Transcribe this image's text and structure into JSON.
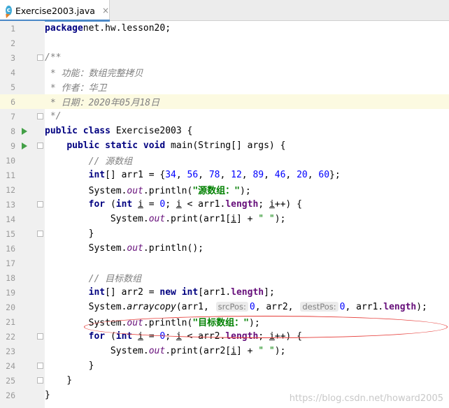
{
  "tab": {
    "filename": "Exercise2003.java",
    "icon": "java-class-icon",
    "close": "×"
  },
  "editor": {
    "current_line": 6,
    "line_numbers": [
      "1",
      "2",
      "3",
      "4",
      "5",
      "6",
      "7",
      "8",
      "9",
      "10",
      "11",
      "12",
      "13",
      "14",
      "15",
      "16",
      "17",
      "18",
      "19",
      "20",
      "21",
      "22",
      "23",
      "24",
      "25",
      "26"
    ],
    "lines": [
      [
        [
          "kw",
          "package"
        ],
        [
          "",
          "net.hw.lesson20;"
        ]
      ],
      [],
      [
        [
          "cmt",
          "/**"
        ]
      ],
      [
        [
          "cmt",
          " * 功能：数组完整拷贝"
        ]
      ],
      [
        [
          "cmt",
          " * 作者：华卫"
        ]
      ],
      [
        [
          "cmt",
          " * 日期：2020年05月18日"
        ]
      ],
      [
        [
          "cmt",
          " */"
        ]
      ],
      [
        [
          "kw",
          "public class "
        ],
        [
          "",
          "Exercise2003 {"
        ]
      ],
      [
        [
          "",
          "    "
        ],
        [
          "kw",
          "public static void "
        ],
        [
          "",
          "main(String[] args) {"
        ]
      ],
      [
        [
          "",
          "        "
        ],
        [
          "cmt",
          "// 源数组"
        ]
      ],
      [
        [
          "",
          "        "
        ],
        [
          "kw",
          "int"
        ],
        [
          "",
          "[] arr1 = {"
        ],
        [
          "num",
          "34"
        ],
        [
          "",
          ", "
        ],
        [
          "num",
          "56"
        ],
        [
          "",
          ", "
        ],
        [
          "num",
          "78"
        ],
        [
          "",
          ", "
        ],
        [
          "num",
          "12"
        ],
        [
          "",
          ", "
        ],
        [
          "num",
          "89"
        ],
        [
          "",
          ", "
        ],
        [
          "num",
          "46"
        ],
        [
          "",
          ", "
        ],
        [
          "num",
          "20"
        ],
        [
          "",
          ", "
        ],
        [
          "num",
          "60"
        ],
        [
          "",
          "};"
        ]
      ],
      [
        [
          "",
          "        System."
        ],
        [
          "stat",
          "out"
        ],
        [
          "",
          ".println("
        ],
        [
          "str",
          "\"源数组：\""
        ],
        [
          "",
          ");"
        ]
      ],
      [
        [
          "",
          "        "
        ],
        [
          "kw",
          "for "
        ],
        [
          "",
          "("
        ],
        [
          "kw",
          "int "
        ],
        [
          "ul",
          "i"
        ],
        [
          "",
          " = "
        ],
        [
          "num",
          "0"
        ],
        [
          "",
          "; "
        ],
        [
          "ul",
          "i"
        ],
        [
          "",
          " < arr1."
        ],
        [
          "fld",
          "length"
        ],
        [
          "",
          "; "
        ],
        [
          "ul",
          "i"
        ],
        [
          "",
          "++) {"
        ]
      ],
      [
        [
          "",
          "            System."
        ],
        [
          "stat",
          "out"
        ],
        [
          "",
          ".print(arr1["
        ],
        [
          "ul",
          "i"
        ],
        [
          "",
          "] + "
        ],
        [
          "strp",
          "\" \""
        ],
        [
          "",
          ");"
        ]
      ],
      [
        [
          "",
          "        }"
        ]
      ],
      [
        [
          "",
          "        System."
        ],
        [
          "stat",
          "out"
        ],
        [
          "",
          ".println();"
        ]
      ],
      [],
      [
        [
          "",
          "        "
        ],
        [
          "cmt",
          "// 目标数组"
        ]
      ],
      [
        [
          "",
          "        "
        ],
        [
          "kw",
          "int"
        ],
        [
          "",
          "[] arr2 = "
        ],
        [
          "kw",
          "new int"
        ],
        [
          "",
          "[arr1."
        ],
        [
          "fld",
          "length"
        ],
        [
          "",
          "];"
        ]
      ],
      [
        [
          "",
          "        System."
        ],
        [
          "ital",
          "arraycopy"
        ],
        [
          "",
          "(arr1, "
        ],
        [
          "hint",
          "srcPos:"
        ],
        [
          "num",
          "0"
        ],
        [
          "",
          ", arr2, "
        ],
        [
          "hint",
          "destPos:"
        ],
        [
          "num",
          "0"
        ],
        [
          "",
          ", arr1."
        ],
        [
          "fld",
          "length"
        ],
        [
          "",
          ");"
        ]
      ],
      [
        [
          "",
          "        System."
        ],
        [
          "stat",
          "out"
        ],
        [
          "",
          ".println("
        ],
        [
          "str",
          "\"目标数组：\""
        ],
        [
          "",
          ");"
        ]
      ],
      [
        [
          "",
          "        "
        ],
        [
          "kw",
          "for "
        ],
        [
          "",
          "("
        ],
        [
          "kw",
          "int "
        ],
        [
          "ul",
          "i"
        ],
        [
          "",
          " = "
        ],
        [
          "num",
          "0"
        ],
        [
          "",
          "; "
        ],
        [
          "ul",
          "i"
        ],
        [
          "",
          " < arr2."
        ],
        [
          "fld",
          "length"
        ],
        [
          "",
          "; "
        ],
        [
          "ul",
          "i"
        ],
        [
          "",
          "++) {"
        ]
      ],
      [
        [
          "",
          "            System."
        ],
        [
          "stat",
          "out"
        ],
        [
          "",
          ".print(arr2["
        ],
        [
          "ul",
          "i"
        ],
        [
          "",
          "] + "
        ],
        [
          "strp",
          "\" \""
        ],
        [
          "",
          ");"
        ]
      ],
      [
        [
          "",
          "        }"
        ]
      ],
      [
        [
          "",
          "    }"
        ]
      ],
      [
        [
          "",
          "}"
        ]
      ]
    ],
    "run_icon_lines": [
      8,
      9
    ],
    "fold_icon_lines": [
      3,
      7,
      9,
      13,
      15,
      22,
      24,
      25
    ],
    "annotation_line": 20
  },
  "watermark": "https://blog.csdn.net/howard2005",
  "colors": {
    "keyword": "#000080",
    "number": "#0000ff",
    "string": "#008000",
    "comment": "#808080",
    "field": "#660e7a",
    "annotation": "#e53935"
  }
}
